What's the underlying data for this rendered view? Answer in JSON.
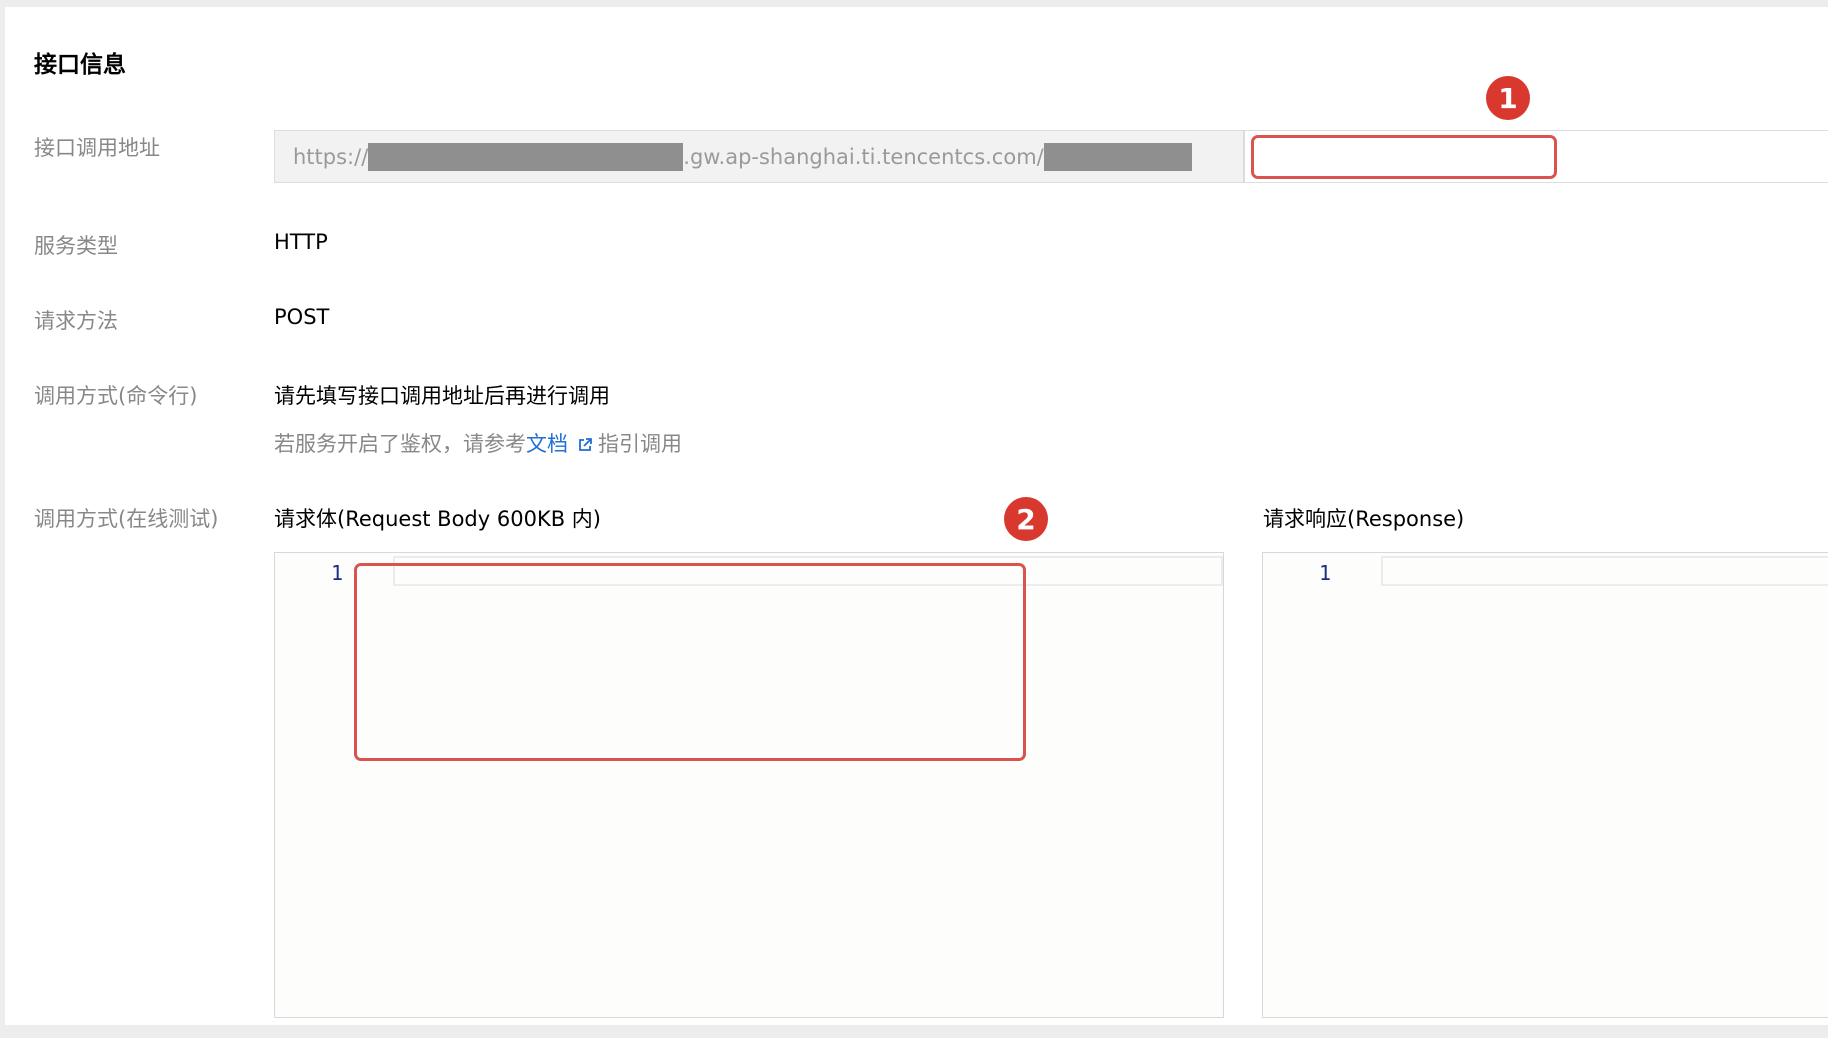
{
  "section_title": "接口信息",
  "api_address": {
    "label": "接口调用地址",
    "url_prefix_start": "https://",
    "url_prefix_mid": ".gw.ap-shanghai.ti.tencentcs.com/",
    "input_value": ""
  },
  "service_type": {
    "label": "服务类型",
    "value": "HTTP"
  },
  "request_method": {
    "label": "请求方法",
    "value": "POST"
  },
  "cli_invoke": {
    "label": "调用方式(命令行)",
    "value": "请先填写接口调用地址后再进行调用",
    "hint_prefix": "若服务开启了鉴权，请参考",
    "hint_link": "文档",
    "hint_suffix": "指引调用"
  },
  "online_test": {
    "label": "调用方式(在线测试)",
    "request_title": "请求体(Request Body 600KB 内)",
    "response_title": "请求响应(Response)",
    "request_line_number": "1",
    "response_line_number": "1"
  },
  "markers": {
    "first": "1",
    "second": "2"
  },
  "colors": {
    "highlight": "#d9534f",
    "marker": "#d9382f",
    "link": "#1f6fd6"
  }
}
